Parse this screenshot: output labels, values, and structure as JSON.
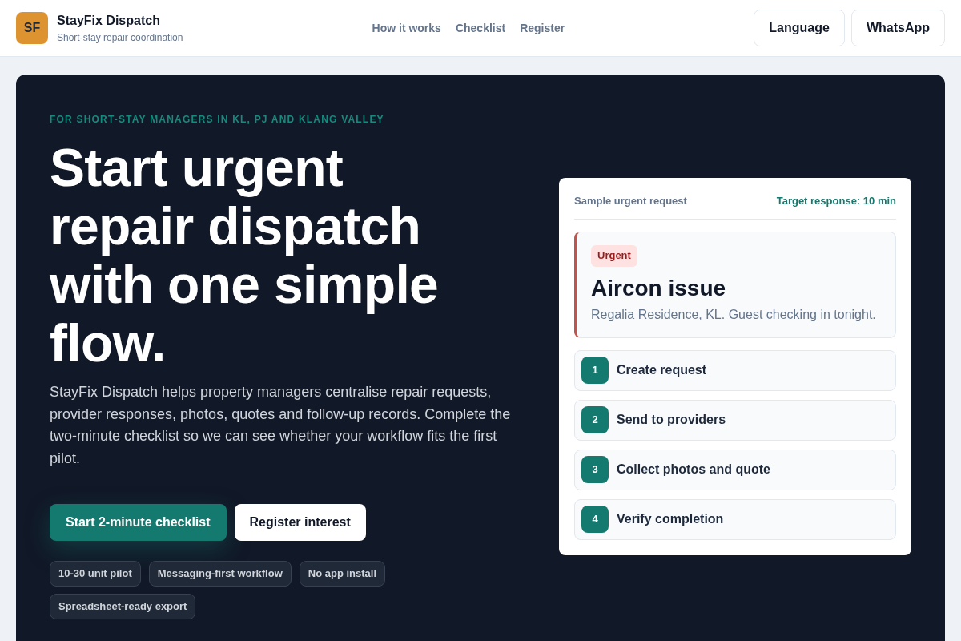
{
  "header": {
    "logo_mark": "SF",
    "brand": "StayFix Dispatch",
    "tagline": "Short-stay repair coordination",
    "nav": [
      "How it works",
      "Checklist",
      "Register"
    ],
    "buttons": [
      "Language",
      "WhatsApp"
    ]
  },
  "hero": {
    "eyebrow": "FOR SHORT-STAY MANAGERS IN KL, PJ AND KLANG VALLEY",
    "heading": "Start urgent repair dispatch with one simple flow.",
    "description": "StayFix Dispatch helps property managers centralise repair requests, provider responses, photos, quotes and follow-up records. Complete the two-minute checklist so we can see whether your workflow fits the first pilot.",
    "buttons": [
      {
        "label": "Start 2-minute checklist",
        "kind": "primary"
      },
      {
        "label": "Register interest",
        "kind": "secondary"
      }
    ],
    "tags": [
      "10-30 unit pilot",
      "Messaging-first workflow",
      "No app install",
      "Spreadsheet-ready export"
    ]
  },
  "sample_card": {
    "title": "Sample urgent request",
    "target": "Target response: 10 min",
    "request": {
      "badge": "Urgent",
      "title": "Aircon issue",
      "details": "Regalia Residence, KL. Guest checking in tonight."
    },
    "steps": [
      {
        "number": "1",
        "label": "Create request"
      },
      {
        "number": "2",
        "label": "Send to providers"
      },
      {
        "number": "3",
        "label": "Collect photos and quote"
      },
      {
        "number": "4",
        "label": "Verify completion"
      }
    ]
  }
}
